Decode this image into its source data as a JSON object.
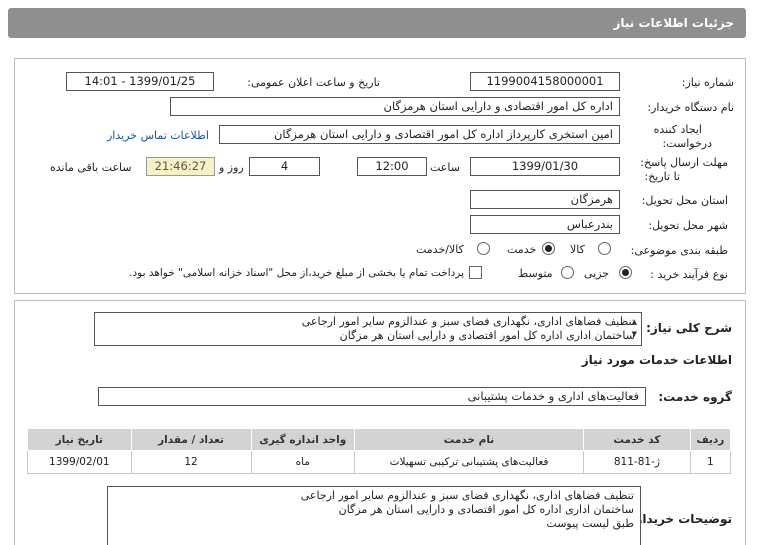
{
  "page": {
    "title": "جزئیات اطلاعات نیاز"
  },
  "need_info": {
    "need_number_label": "شماره نیاز:",
    "need_number": "1199004158000001",
    "announce_label": "تاریخ و ساعت اعلان عمومی:",
    "announce_value": "1399/01/25 - 14:01",
    "buyer_label": "نام دستگاه خریدار:",
    "buyer_value": "اداره کل امور اقتصادی و دارایی استان هرمزگان",
    "requester_label_1": "ایجاد کننده",
    "requester_label_2": "درخواست:",
    "requester_value": "امین استخری کارپرداز اداره کل امور اقتصادی و دارایی استان هرمزگان",
    "contact_link": "اطلاعات تماس خریدار",
    "deadline_label_1": "مهلت ارسال پاسخ:",
    "deadline_label_2": "تا تاریخ:",
    "deadline_date": "1399/01/30",
    "time_label": "ساعت",
    "deadline_time": "12:00",
    "days_value": "4",
    "days_label": "روز و",
    "remaining_time": "21:46:27",
    "remaining_label": "ساعت باقی مانده",
    "province_label": "استان محل تحویل:",
    "province_value": "هرمزگان",
    "city_label": "شهر محل تحویل:",
    "city_value": "بندرعباس",
    "category_label": "طبقه بندی موضوعی:",
    "category_options": [
      "کالا",
      "خدمت",
      "کالا/خدمت"
    ],
    "category_selected": "خدمت",
    "process_label": "نوع فرآیند خرید :",
    "process_options": [
      "جزیی",
      "متوسط"
    ],
    "process_selected": "جزیی",
    "payment_note": "پرداخت تمام یا بخشی از مبلغ خرید،از محل \"اسناد خزانه اسلامی\" خواهد بود."
  },
  "summary": {
    "label": "شرح کلی نیاز:",
    "line1": "تنظیف فضاهای اداری، نگهداری فضای سبز و عندالزوم سایر امور ارجاعی",
    "line2": "ساختمان اداری اداره کل امور اقتصادی و دارایی استان هر مزگان"
  },
  "services_section": {
    "title": "اطلاعات خدمات مورد نیاز",
    "group_label": "گروه خدمت:",
    "group_value": "فعالیت‌های اداری و خدمات پشتیبانی"
  },
  "table": {
    "headers": [
      "ردیف",
      "کد خدمت",
      "نام خدمت",
      "واحد اندازه گیری",
      "تعداد / مقدار",
      "تاریخ نیاز"
    ],
    "rows": [
      [
        "1",
        "ژ-81-811",
        "فعالیت‌های پشتیبانی ترکیبی تسهیلات",
        "ماه",
        "12",
        "1399/02/01"
      ]
    ]
  },
  "buyer_notes": {
    "label": "توضیحات خریدار:",
    "line1": "تنظیف فضاهای اداری، نگهداری فضای سبز و عندالزوم سایر امور ارجاعی",
    "line2": "ساختمان اداری اداره کل امور اقتصادی و دارایی استان هر مزگان",
    "line3": "طبق لیست پیوست"
  },
  "colors": {
    "header": "#8f8f8f",
    "remaining_bg": "#f7f1c6",
    "link": "#1a4fa8",
    "table_header": "#d3d3d3"
  }
}
